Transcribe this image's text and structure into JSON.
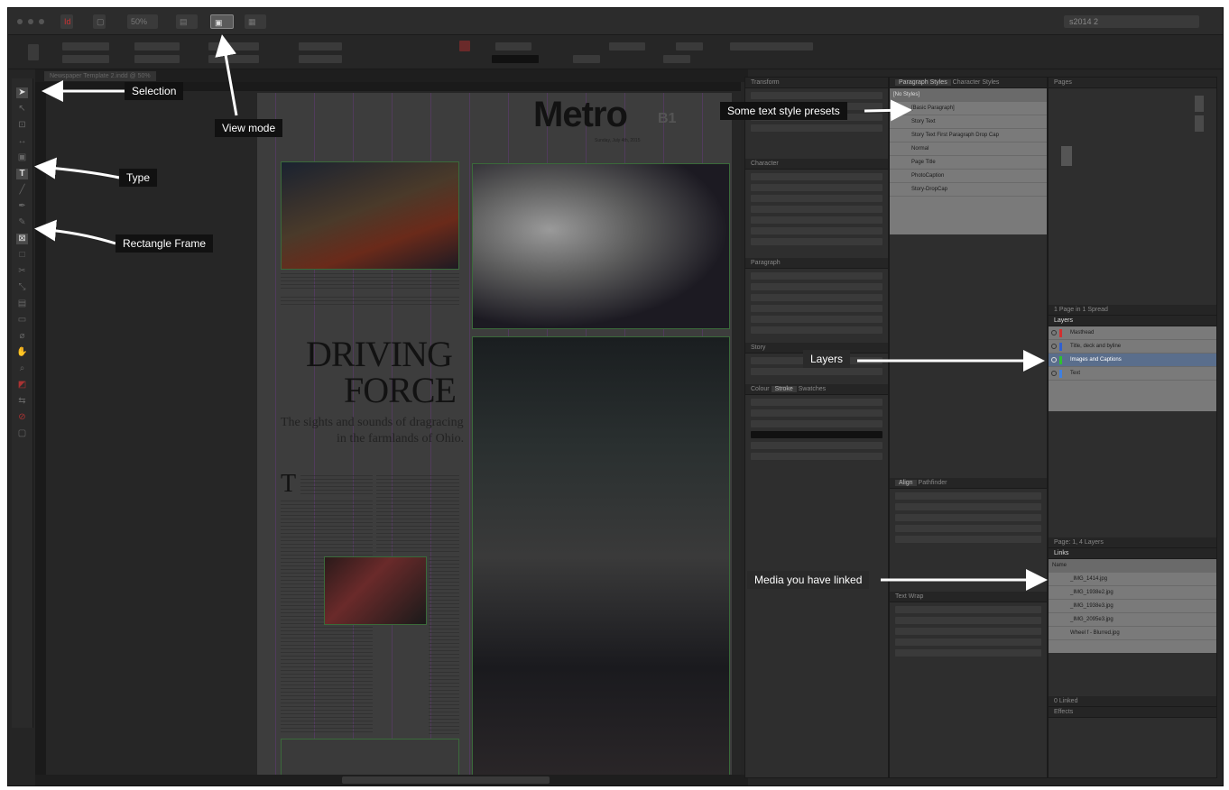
{
  "app": {
    "zoom": "50%",
    "workspace": "s2014 2",
    "document_tab": "Newspaper Template 2.indd @ 50%"
  },
  "document": {
    "masthead": "Metro",
    "section": "B1",
    "dateline": "Sunday, July 4th, 2015",
    "headline_line1": "DRIVING",
    "headline_line2": "FORCE",
    "deck_line1": "The sights and sounds of dragracing",
    "deck_line2": "in the farmlands of Ohio."
  },
  "panels": {
    "transform": "Transform",
    "character": "Character",
    "paragraph": "Paragraph",
    "story": "Story",
    "stroke_tabs": [
      "Colour",
      "Stroke",
      "Swatches"
    ],
    "align_tabs": [
      "Align",
      "Pathfinder"
    ],
    "text_wrap": "Text Wrap",
    "pages": "Pages",
    "pages_footer": "1 Page in 1 Spread",
    "layers": "Layers",
    "layers_footer": "Page: 1, 4 Layers",
    "links": "Links",
    "links_name_col": "Name",
    "links_footer": "0 Linked",
    "effects": "Effects"
  },
  "paragraph_styles": {
    "tabs": [
      "Paragraph Styles",
      "Character Styles"
    ],
    "current": "[No Styles]",
    "items": [
      "[Basic Paragraph]",
      "Story Text",
      "Story Text First Paragraph Drop Cap",
      "Normal",
      "Page Title",
      "PhotoCaption",
      "Story-DropCap"
    ]
  },
  "layers": [
    {
      "name": "Masthead",
      "color": "#d23030"
    },
    {
      "name": "Title, deck and byline",
      "color": "#3060d0"
    },
    {
      "name": "Images and Captions",
      "color": "#30c030"
    },
    {
      "name": "Text",
      "color": "#4080e0"
    }
  ],
  "links": [
    "_IMG_1414.jpg",
    "_IMG_1938e2.jpg",
    "_IMG_1938e3.jpg",
    "_IMG_2095e3.jpg",
    "Wheel f - Blurred.jpg"
  ],
  "callouts": {
    "selection": "Selection",
    "view_mode": "View mode",
    "type": "Type",
    "rectangle_frame": "Rectangle Frame",
    "text_presets": "Some text style presets",
    "layers": "Layers",
    "media": "Media you have linked"
  },
  "icons": [
    "selection-tool-icon",
    "direct-selection-icon",
    "type-tool-icon",
    "pen-tool-icon",
    "pencil-tool-icon",
    "rectangle-frame-icon",
    "view-mode-icon",
    "eye-icon"
  ],
  "colors": {
    "annotation_bg": "#111111",
    "annotation_text": "#ffffff",
    "highlight_layer": "#5a6e8c"
  }
}
